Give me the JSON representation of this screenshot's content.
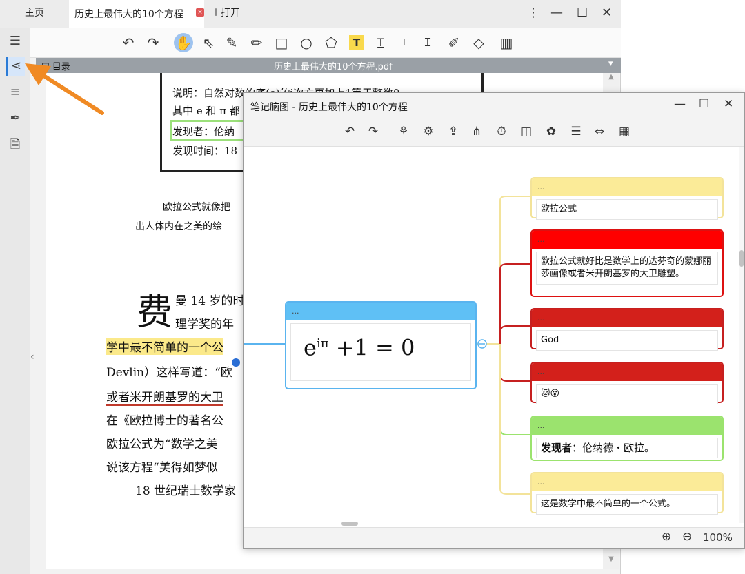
{
  "app": {
    "tabs": {
      "home": "主页",
      "doc": "历史上最伟大的10个方程",
      "close_icon": "×",
      "open": "＋打开"
    },
    "window_controls": {
      "more": "⋮",
      "minimize": "—",
      "maximize": "☐",
      "close": "✕"
    },
    "subbar": {
      "toc": "目录",
      "pdf_name": "历史上最伟大的10个方程.pdf",
      "dropdown": "▾"
    }
  },
  "document": {
    "box_lines": [
      "说明：自然对数的底(e)的i次方再加上1等于整数0",
      "其中 e 和 π 都",
      "发现者：伦纳",
      "发现时间：18"
    ],
    "caption_lines": [
      "欧拉公式就像把",
      "出人体内在之美的绘"
    ],
    "big_char": "费",
    "para1_a": "曼 14 岁的时",
    "para1_b": "理学奖的年",
    "line_hl": "学中最不简单的一个公",
    "line_devlin": "Devlin）这样写道：“欧",
    "line_ul": "或者米开朗基罗的大卫",
    "line_4": "在《欧拉博士的著名公",
    "line_5": "欧拉公式为“数学之美",
    "line_6": "说该方程“美得如梦似",
    "line_7": "18 世纪瑞士数学家"
  },
  "mindmap": {
    "title": "笔记脑图 - 历史上最伟大的10个方程",
    "window_controls": {
      "minimize": "—",
      "maximize": "☐",
      "close": "✕"
    },
    "root": {
      "header": "...",
      "formula_base": "e",
      "formula_exp": "iπ",
      "formula_rest": "+1 = 0"
    },
    "nodes": [
      {
        "header": "...",
        "text": "欧拉公式",
        "color": "yellow"
      },
      {
        "header": "...",
        "text": "欧拉公式就好比是数学上的达芬奇的蒙娜丽莎画像或者米开朗基罗的大卫雕塑。",
        "color": "red"
      },
      {
        "header": "...",
        "text": "God",
        "color": "darkred"
      },
      {
        "header": "...",
        "text": "🐱😮",
        "color": "darkred"
      },
      {
        "header": "...",
        "text_bold": "发现者",
        "text": "：伦纳德・欧拉。",
        "color": "green"
      },
      {
        "header": "...",
        "text": "这是数学中最不简单的一个公式。",
        "color": "yellow"
      }
    ],
    "status": {
      "zoom_in": "⊕",
      "zoom_out": "⊖",
      "zoom": "100%"
    }
  },
  "colors": {
    "accent_blue": "#5ab4ef",
    "red": "#ff0000",
    "dark_red": "#d3201b",
    "green": "#9be36e",
    "yellow": "#fbeb98",
    "orange_arrow": "#f08a24"
  }
}
